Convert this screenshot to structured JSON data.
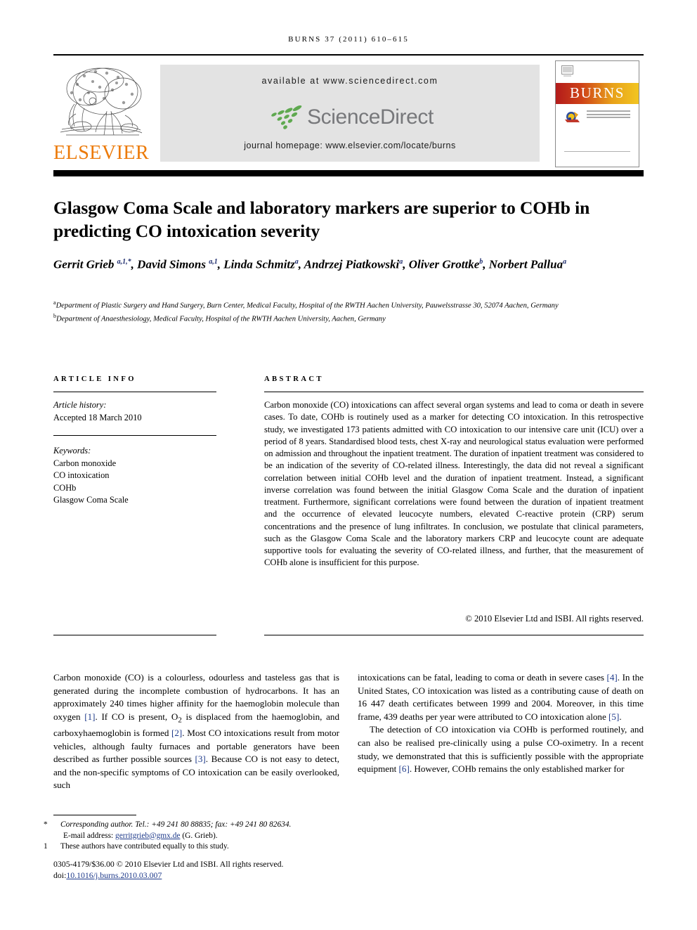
{
  "running_head": "BURNS 37 (2011) 610–615",
  "masthead": {
    "elsevier_wordmark": "ELSEVIER",
    "available_at": "available at www.sciencedirect.com",
    "sciencedirect_wordmark": "ScienceDirect",
    "journal_homepage": "journal homepage: www.elsevier.com/locate/burns",
    "cover_title": "BURNS"
  },
  "article": {
    "title": "Glasgow Coma Scale and laboratory markers are superior to COHb in predicting CO intoxication severity",
    "authors_line1_pre": "Gerrit Grieb",
    "authors_html": "Gerrit Grieb <sup>a,1,*</sup>, David Simons <sup>a,1</sup>, Linda Schmitz<sup>a</sup>, Andrzej Piatkowski<sup>a</sup>, Oliver Grottke<sup>b</sup>, Norbert Pallua<sup>a</sup>",
    "affiliation_a": "Department of Plastic Surgery and Hand Surgery, Burn Center, Medical Faculty, Hospital of the RWTH Aachen University, Pauwelsstrasse 30, 52074 Aachen, Germany",
    "affiliation_b": "Department of Anaesthesiology, Medical Faculty, Hospital of the RWTH Aachen University, Aachen, Germany",
    "affiliation_a_marker": "a",
    "affiliation_b_marker": "b"
  },
  "article_info": {
    "heading": "ARTICLE INFO",
    "history_label": "Article history:",
    "history_value": "Accepted 18 March 2010",
    "keywords_label": "Keywords:",
    "keywords": [
      "Carbon monoxide",
      "CO intoxication",
      "COHb",
      "Glasgow Coma Scale"
    ]
  },
  "abstract": {
    "heading": "ABSTRACT",
    "text": "Carbon monoxide (CO) intoxications can affect several organ systems and lead to coma or death in severe cases. To date, COHb is routinely used as a marker for detecting CO intoxication. In this retrospective study, we investigated 173 patients admitted with CO intoxication to our intensive care unit (ICU) over a period of 8 years. Standardised blood tests, chest X-ray and neurological status evaluation were performed on admission and throughout the inpatient treatment. The duration of inpatient treatment was considered to be an indication of the severity of CO-related illness. Interestingly, the data did not reveal a significant correlation between initial COHb level and the duration of inpatient treatment. Instead, a significant inverse correlation was found between the initial Glasgow Coma Scale and the duration of inpatient treatment. Furthermore, significant correlations were found between the duration of inpatient treatment and the occurrence of elevated leucocyte numbers, elevated C-reactive protein (CRP) serum concentrations and the presence of lung infiltrates. In conclusion, we postulate that clinical parameters, such as the Glasgow Coma Scale and the laboratory markers CRP and leucocyte count are adequate supportive tools for evaluating the severity of CO-related illness, and further, that the measurement of COHb alone is insufficient for this purpose.",
    "copyright": "© 2010 Elsevier Ltd and ISBI. All rights reserved."
  },
  "body": {
    "left_column_html": "<p>Carbon monoxide (CO) is a colourless, odourless and tasteless gas that is generated during the incomplete combustion of hydrocarbons. It has an approximately 240 times higher affinity for the haemoglobin molecule than oxygen <span class=\"ref\">[1]</span>. If CO is present, O<sub>2</sub> is displaced from the haemoglobin, and carboxyhaemoglobin is formed <span class=\"ref\">[2]</span>. Most CO intoxications result from motor vehicles, although faulty furnaces and portable generators have been described as further possible sources <span class=\"ref\">[3]</span>. Because CO is not easy to detect, and the non-specific symptoms of CO intoxication can be easily overlooked, such</p>",
    "right_column_html": "<p>intoxications can be fatal, leading to coma or death in severe cases <span class=\"ref\">[4]</span>. In the United States, CO intoxication was listed as a contributing cause of death on 16 447 death certificates between 1999 and 2004. Moreover, in this time frame, 439 deaths per year were attributed to CO intoxication alone <span class=\"ref\">[5]</span>.</p><p>The detection of CO intoxication via COHb is performed routinely, and can also be realised pre-clinically using a pulse CO-oximetry. In a recent study, we demonstrated that this is sufficiently possible with the appropriate equipment <span class=\"ref\">[6]</span>. However, COHb remains the only established marker for</p>"
  },
  "footnotes": {
    "corresponding_symbol": "*",
    "corresponding_text": "Corresponding author. Tel.: +49 241 80 88835; fax: +49 241 80 82634.",
    "email_label": "E-mail address:",
    "email_address": "gerritgrieb@gmx.de",
    "email_attribution": "(G. Grieb).",
    "equal_symbol": "1",
    "equal_text": "These authors have contributed equally to this study.",
    "issn_line": "0305-4179/$36.00 © 2010 Elsevier Ltd and ISBI. All rights reserved.",
    "doi_label": "doi:",
    "doi_value": "10.1016/j.burns.2010.03.007"
  },
  "colors": {
    "elsevier_orange": "#ec7a08",
    "sciencedirect_green": "#5fa950",
    "sciencedirect_gray": "#77787b",
    "reference_blue": "#1e3a8a",
    "banner_gray": "#e3e3e3"
  }
}
